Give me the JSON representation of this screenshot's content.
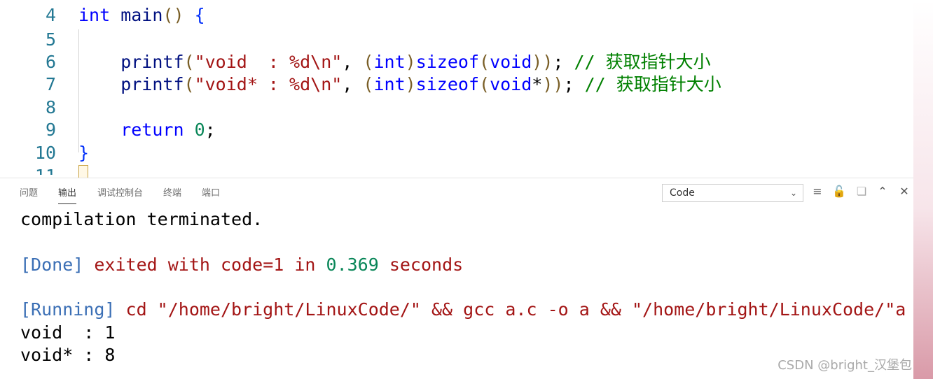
{
  "editor": {
    "lines": [
      {
        "num": "4",
        "parts": [
          {
            "t": "int",
            "c": "kw"
          },
          {
            "t": " main",
            "c": "fn"
          },
          {
            "t": "()",
            "c": "paren"
          },
          {
            "t": " {",
            "c": "brace"
          }
        ]
      },
      {
        "num": "5",
        "parts": []
      },
      {
        "num": "6",
        "parts": [
          {
            "t": "    printf",
            "c": "fn"
          },
          {
            "t": "(",
            "c": "paren"
          },
          {
            "t": "\"void  : %d\\n\"",
            "c": "str"
          },
          {
            "t": ", ",
            "c": "plain"
          },
          {
            "t": "(",
            "c": "paren"
          },
          {
            "t": "int",
            "c": "kw"
          },
          {
            "t": ")",
            "c": "paren"
          },
          {
            "t": "sizeof",
            "c": "kw"
          },
          {
            "t": "(",
            "c": "paren"
          },
          {
            "t": "void",
            "c": "kw"
          },
          {
            "t": "))",
            "c": "paren"
          },
          {
            "t": "; ",
            "c": "plain"
          },
          {
            "t": "// 获取指针大小",
            "c": "cm"
          }
        ]
      },
      {
        "num": "7",
        "parts": [
          {
            "t": "    printf",
            "c": "fn"
          },
          {
            "t": "(",
            "c": "paren"
          },
          {
            "t": "\"void* : %d\\n\"",
            "c": "str"
          },
          {
            "t": ", ",
            "c": "plain"
          },
          {
            "t": "(",
            "c": "paren"
          },
          {
            "t": "int",
            "c": "kw"
          },
          {
            "t": ")",
            "c": "paren"
          },
          {
            "t": "sizeof",
            "c": "kw"
          },
          {
            "t": "(",
            "c": "paren"
          },
          {
            "t": "void",
            "c": "kw"
          },
          {
            "t": "*",
            "c": "plain"
          },
          {
            "t": "))",
            "c": "paren"
          },
          {
            "t": "; ",
            "c": "plain"
          },
          {
            "t": "// 获取指针大小",
            "c": "cm"
          }
        ]
      },
      {
        "num": "8",
        "parts": []
      },
      {
        "num": "9",
        "parts": [
          {
            "t": "    return",
            "c": "kw"
          },
          {
            "t": " ",
            "c": "plain"
          },
          {
            "t": "0",
            "c": "num"
          },
          {
            "t": ";",
            "c": "plain"
          }
        ]
      },
      {
        "num": "10",
        "parts": [
          {
            "t": "}",
            "c": "brace"
          }
        ]
      },
      {
        "num": "11",
        "parts": []
      }
    ]
  },
  "panel": {
    "tabs": [
      "问题",
      "输出",
      "调试控制台",
      "终端",
      "端口"
    ],
    "active_tab": "输出",
    "channel_select": "Code",
    "icons": [
      "list-filter-icon",
      "lock-icon",
      "copy-icon",
      "chevron-up-icon",
      "close-icon"
    ]
  },
  "output": {
    "lines": [
      {
        "parts": [
          {
            "t": "compilation terminated.",
            "c": "o-plain"
          }
        ]
      },
      {
        "parts": []
      },
      {
        "parts": [
          {
            "t": "[Done]",
            "c": "o-blue"
          },
          {
            "t": " exited with ",
            "c": "o-red"
          },
          {
            "t": "code=1",
            "c": "o-red"
          },
          {
            "t": " in ",
            "c": "o-red"
          },
          {
            "t": "0.369",
            "c": "o-green"
          },
          {
            "t": " seconds",
            "c": "o-red"
          }
        ]
      },
      {
        "parts": []
      },
      {
        "parts": [
          {
            "t": "[Running]",
            "c": "o-blue"
          },
          {
            "t": " cd \"/home/bright/LinuxCode/\" && gcc a.c -o a && \"/home/bright/LinuxCode/\"a",
            "c": "o-red"
          }
        ]
      },
      {
        "parts": [
          {
            "t": "void  : 1",
            "c": "o-plain"
          }
        ]
      },
      {
        "parts": [
          {
            "t": "void* : 8",
            "c": "o-plain"
          }
        ]
      }
    ]
  },
  "watermark": "CSDN @bright_汉堡包"
}
